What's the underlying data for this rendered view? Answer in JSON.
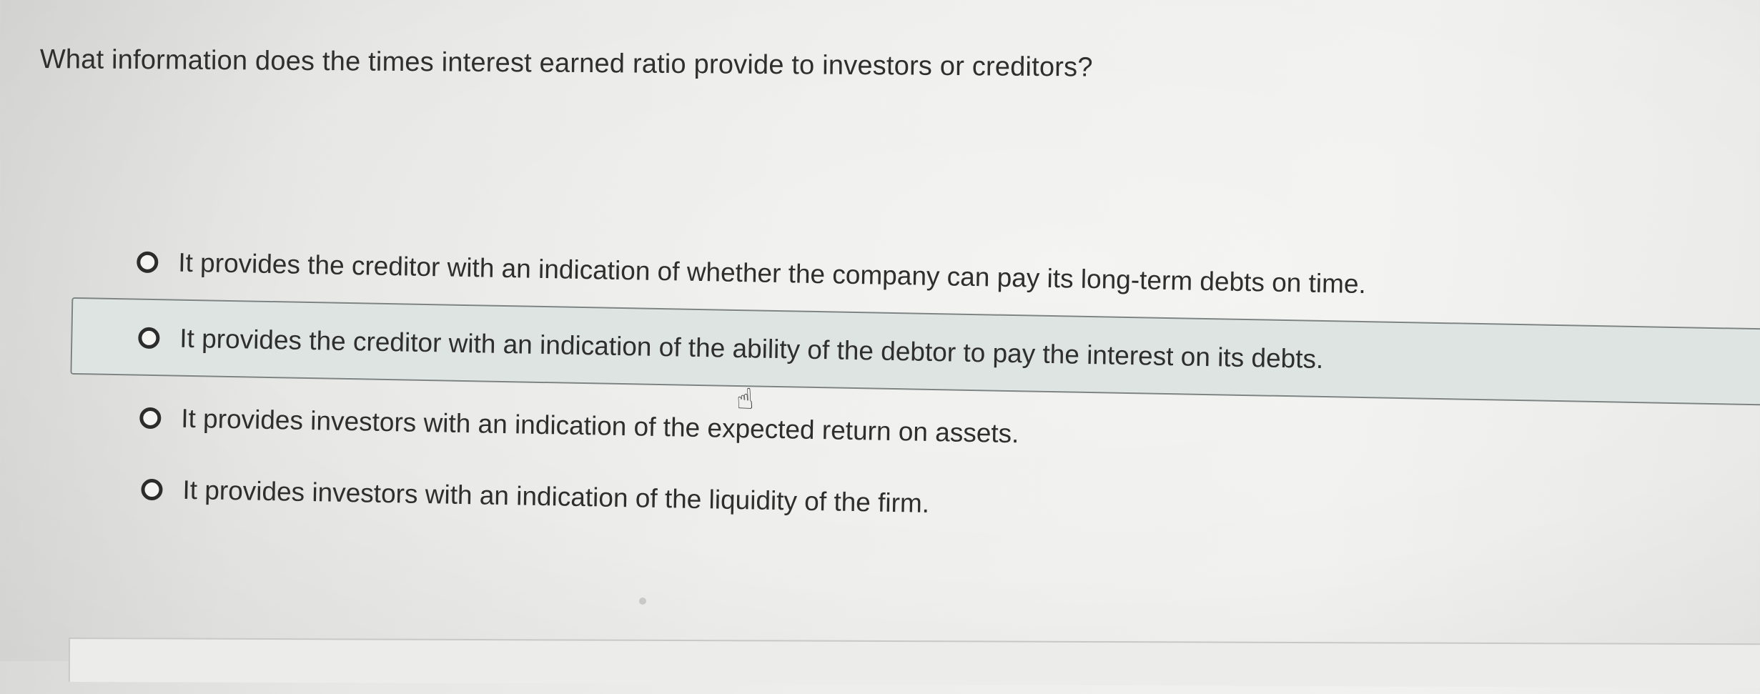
{
  "question": {
    "text": "What information does the times interest earned ratio provide to investors or creditors?"
  },
  "options": [
    {
      "label": "It provides the creditor with an indication of whether the company can pay its long-term debts on time.",
      "selected": false
    },
    {
      "label": "It provides the creditor with an indication of the ability of the debtor to pay the interest on its debts.",
      "selected": false,
      "hovered": true
    },
    {
      "label": "It provides investors with an indication of the expected return on assets.",
      "selected": false
    },
    {
      "label": "It provides investors with an indication of the liquidity of the firm.",
      "selected": false
    }
  ],
  "icons": {
    "radio": "radio-button-icon",
    "cursor": "hand-pointer-icon"
  },
  "colors": {
    "background": "#eeeeec",
    "hover_highlight": "#dde4e2",
    "hover_border": "#7d8483",
    "text": "#2e2e2e"
  }
}
